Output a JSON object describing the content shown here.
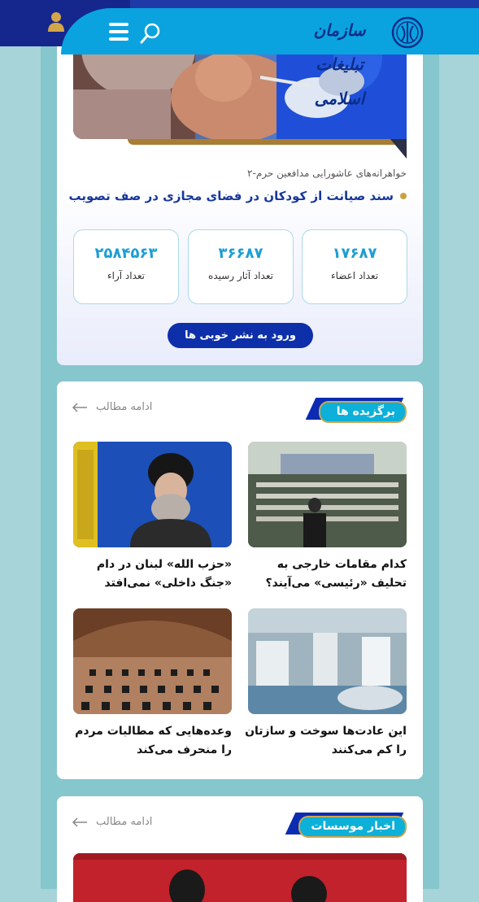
{
  "header": {
    "logo_text": "سازمان تبلیغات اسلامی",
    "icons": [
      "user-icon",
      "menu-icon",
      "search-icon"
    ],
    "colors": {
      "bar": "#0aa3e0",
      "dark": "#15278c"
    }
  },
  "featured": {
    "subhead": "خواهرانه‌های عاشورایی مدافعین حرم-۲",
    "headline": "سند صیانت از کودکان در فضای مجازی در صف تصویب",
    "stats": [
      {
        "value": "۱۷۶۸۷",
        "label": "تعداد اعضاء"
      },
      {
        "value": "۳۶۶۸۷",
        "label": "تعداد آثار رسیده"
      },
      {
        "value": "۲۵۸۴۵۶۳",
        "label": "تعداد آراء"
      }
    ],
    "enter_button": "ورود به نشر خوبی ها"
  },
  "sections": [
    {
      "title": "برگزیده ها",
      "more": "ادامه مطالب",
      "items": [
        {
          "caption": "کدام مقامات خارجی به تحلیف «رئیسی» می‌آیند؟"
        },
        {
          "caption": "«حزب الله» لبنان در دام «جنگ داخلی» نمی‌افتد"
        },
        {
          "caption": "این عادت‌ها سوخت و سازتان را کم می‌کنند"
        },
        {
          "caption": "وعده‌هایی که مطالبات مردم را منحرف می‌کند"
        }
      ]
    },
    {
      "title": "اخبار موسسات",
      "more": "ادامه مطالب"
    }
  ],
  "colors": {
    "accent": "#c9a144",
    "brand_blue": "#0d2faa",
    "cyan": "#0cb0d9"
  }
}
